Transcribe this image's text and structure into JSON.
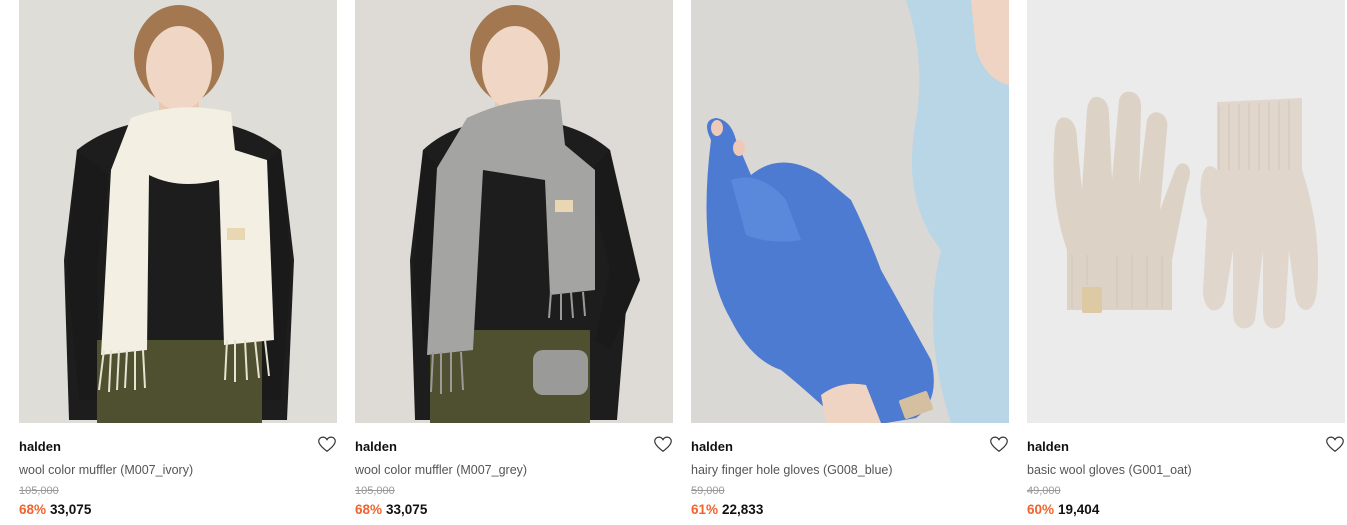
{
  "products": [
    {
      "brand": "halden",
      "name": "wool color muffler (M007_ivory)",
      "original_price": "105,000",
      "discount": "68%",
      "price": "33,075",
      "image_subject": "model-ivory-scarf"
    },
    {
      "brand": "halden",
      "name": "wool color muffler (M007_grey)",
      "original_price": "105,000",
      "discount": "68%",
      "price": "33,075",
      "image_subject": "model-grey-scarf"
    },
    {
      "brand": "halden",
      "name": "hairy finger hole gloves (G008_blue)",
      "original_price": "59,000",
      "discount": "61%",
      "price": "22,833",
      "image_subject": "blue-fuzzy-gloves"
    },
    {
      "brand": "halden",
      "name": "basic wool gloves (G001_oat)",
      "original_price": "49,000",
      "discount": "60%",
      "price": "19,404",
      "image_subject": "oat-wool-gloves"
    }
  ],
  "colors": {
    "discount": "#f0642d",
    "price": "#111111",
    "original_price": "#999999"
  },
  "icons": {
    "wishlist": "heart-outline-icon"
  }
}
